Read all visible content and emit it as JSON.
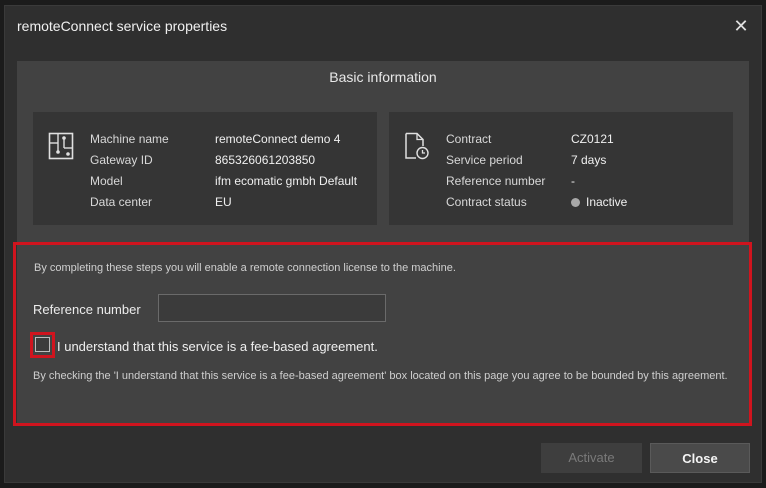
{
  "dialog": {
    "title": "remoteConnect service properties",
    "close_glyph": "✕"
  },
  "basic_info": {
    "heading": "Basic information",
    "machine_card": {
      "icon": "machine-diagram-icon",
      "rows": [
        {
          "label": "Machine name",
          "value": "remoteConnect demo 4"
        },
        {
          "label": "Gateway ID",
          "value": "865326061203850"
        },
        {
          "label": "Model",
          "value": "ifm ecomatic gmbh Default"
        },
        {
          "label": "Data center",
          "value": "EU"
        }
      ]
    },
    "contract_card": {
      "icon": "contract-clock-icon",
      "rows": [
        {
          "label": "Contract",
          "value": "CZ0121"
        },
        {
          "label": "Service period",
          "value": "7 days"
        },
        {
          "label": "Reference number",
          "value": "-"
        },
        {
          "label": "Contract status",
          "value": "Inactive"
        }
      ],
      "status_color": "#a8a8a8"
    }
  },
  "activation": {
    "info": "By completing these steps you will enable a remote connection license to the machine.",
    "reference_label": "Reference number",
    "reference_value": "",
    "reference_placeholder": "",
    "checkbox_label": "I understand that this service is a fee-based agreement.",
    "checkbox_checked": false,
    "agreement_text": "By checking the 'I understand that this service is a fee-based agreement' box located on this page you agree to be bounded by this agreement.",
    "highlight_color": "#d0141e"
  },
  "footer": {
    "activate_label": "Activate",
    "close_label": "Close"
  }
}
